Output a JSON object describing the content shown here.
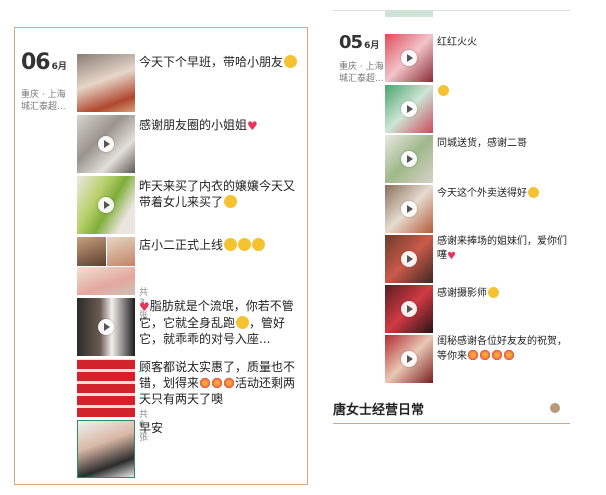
{
  "left_panel": {
    "date_day": "06",
    "date_month": "6月",
    "location_line1": "重庆 · 上海",
    "location_line2": "城汇泰超...",
    "posts": [
      {
        "text": "今天下个早班，带哈小朋友",
        "emoji": "grin-emoji",
        "video": false
      },
      {
        "text": "感谢朋友圈的小姐姐",
        "emoji": "heart",
        "video": true
      },
      {
        "text": "昨天来买了内衣的嬢嬢今天又带着女儿来买了",
        "emoji": "grin-emoji",
        "video": true
      },
      {
        "text": "店小二正式上线",
        "emoji": "grin-emoji",
        "video": false,
        "count": "共3张"
      },
      {
        "text": "脂肪就是个流氓，你若不管它，它就全身乱跑",
        "text2": "，管好它，就乖乖的对号入座...",
        "video": true
      },
      {
        "text": "顾客都说太实惠了，质量也不错，划得来",
        "text2": "活动还剩两天只有两天了噢",
        "video": false,
        "count": "共6张"
      },
      {
        "text": "早安",
        "video": false
      }
    ]
  },
  "right_panel": {
    "date_day": "05",
    "date_month": "6月",
    "location_line1": "重庆 · 上海",
    "location_line2": "城汇泰超...",
    "posts": [
      {
        "text": "红红火火"
      },
      {
        "text": ""
      },
      {
        "text": "同城送货，感谢二哥"
      },
      {
        "text": "今天这个外卖送得好"
      },
      {
        "text": "感谢来捧场的姐妹们，爱你们噻"
      },
      {
        "text": "感谢摄影师"
      },
      {
        "text": "闺秘感谢各位好友友的祝贺，等你来"
      }
    ]
  },
  "footer": {
    "title": "唐女士经营日常",
    "accent_color": "#b89a7a"
  }
}
